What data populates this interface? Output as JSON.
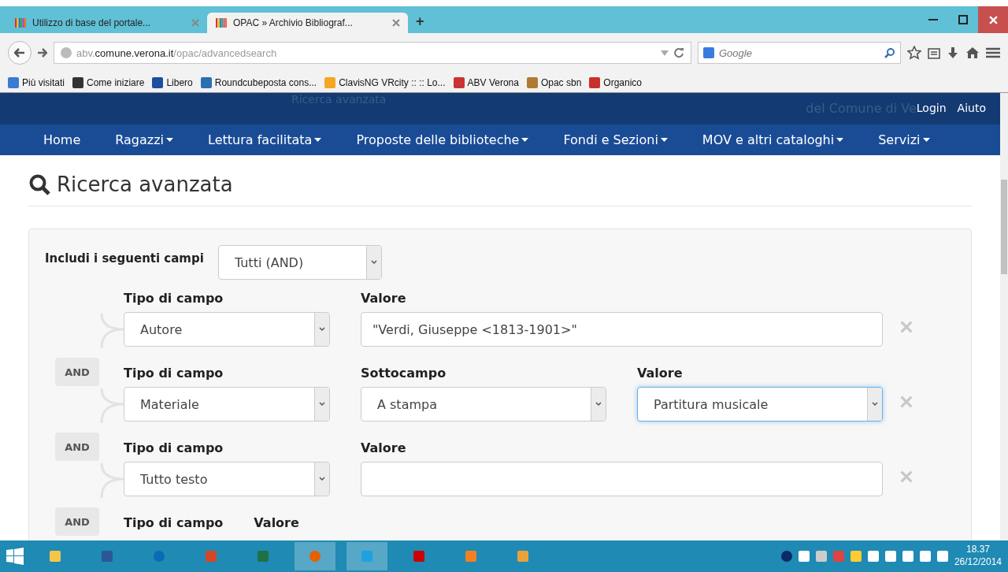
{
  "browser": {
    "tabs": [
      {
        "title": "Utilizzo di base del portale...",
        "selected": false
      },
      {
        "title": "OPAC » Archivio Bibliograf...",
        "selected": true
      }
    ],
    "new_tab": "+",
    "url": {
      "host_prefix": "abv.",
      "domain": "comune.verona.it",
      "path": "/opac/advancedsearch"
    },
    "search": {
      "placeholder": "Google"
    },
    "bookmarks": [
      "Più visitati",
      "Come iniziare",
      "Libero",
      "Roundcubeposta cons...",
      "ClavisNG VRcity :: :: Lo...",
      "ABV Verona",
      "Opac sbn",
      "Organico"
    ]
  },
  "site": {
    "header_faded": "Ricerca avanzata",
    "header_faded_right": "del Comune di Ve",
    "header_links": [
      "Login",
      "Aiuto"
    ],
    "nav": [
      {
        "label": "Home",
        "dropdown": false
      },
      {
        "label": "Ragazzi",
        "dropdown": true
      },
      {
        "label": "Lettura facilitata",
        "dropdown": true
      },
      {
        "label": "Proposte delle biblioteche",
        "dropdown": true
      },
      {
        "label": "Fondi e Sezioni",
        "dropdown": true
      },
      {
        "label": "MOV e altri cataloghi",
        "dropdown": true
      },
      {
        "label": "Servizi",
        "dropdown": true
      }
    ]
  },
  "page": {
    "title": "Ricerca avanzata",
    "include_label": "Includi i seguenti campi",
    "include_value": "Tutti (AND)",
    "rows": [
      {
        "operator": null,
        "type_label": "Tipo di campo",
        "type_value": "Autore",
        "fields": [
          {
            "label": "Valore",
            "value": "\"Verdi, Giuseppe <1813-1901>\"",
            "kind": "input",
            "focused": false
          }
        ]
      },
      {
        "operator": "AND",
        "type_label": "Tipo di campo",
        "type_value": "Materiale",
        "fields": [
          {
            "label": "Sottocampo",
            "value": "A stampa",
            "kind": "select",
            "focused": false
          },
          {
            "label": "Valore",
            "value": "Partitura musicale",
            "kind": "select",
            "focused": true
          }
        ]
      },
      {
        "operator": "AND",
        "type_label": "Tipo di campo",
        "type_value": "Tutto testo",
        "fields": [
          {
            "label": "Valore",
            "kind": "input",
            "focused": false
          }
        ]
      },
      {
        "operator": "AND",
        "type_label": "Tipo di campo",
        "type_value": null,
        "fields": [
          {
            "label": "Valore",
            "kind": "none"
          }
        ]
      }
    ]
  },
  "taskbar": {
    "time": "18.37",
    "date": "26/12/2014"
  }
}
